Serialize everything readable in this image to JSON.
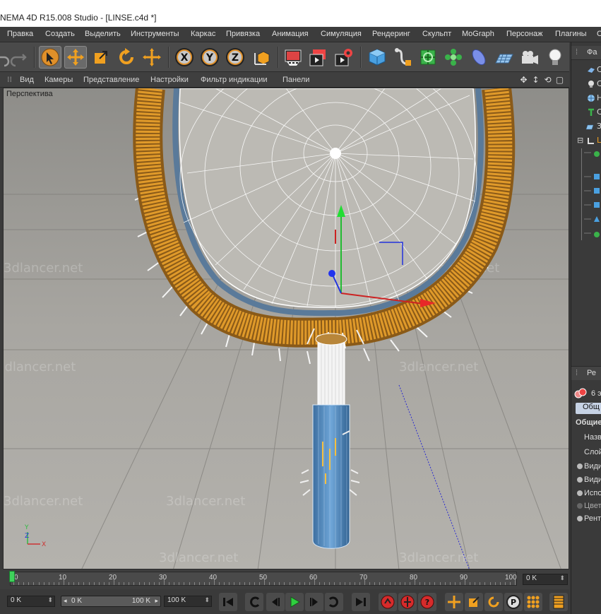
{
  "window": {
    "title": "NEMA 4D R15.008 Studio - [LINSE.c4d *]"
  },
  "menu": {
    "items": [
      "Правка",
      "Создать",
      "Выделить",
      "Инструменты",
      "Каркас",
      "Привязка",
      "Анимация",
      "Симуляция",
      "Рендеринг",
      "Скульпт",
      "MoGraph",
      "Персонаж",
      "Плагины",
      "С"
    ]
  },
  "toolbar": {
    "tools": [
      "undo-icon",
      "redo-icon",
      "select-arrow-icon",
      "move-icon",
      "scale-icon",
      "rotate-icon",
      "move-plus-icon",
      "x-axis-icon",
      "y-axis-icon",
      "z-axis-icon",
      "coordinate-system-icon",
      "render-view-icon",
      "render-picture-queue-icon",
      "render-settings-icon",
      "cube-icon",
      "spline-pen-icon",
      "subdivision-icon",
      "cloner-icon",
      "deformer-icon",
      "floor-icon",
      "camera-icon",
      "light-icon"
    ]
  },
  "viewport_menu": {
    "items": [
      "Вид",
      "Камеры",
      "Представление",
      "Настройки",
      "Фильтр индикации",
      "Панели"
    ]
  },
  "viewport": {
    "label": "Перспектива",
    "watermark": "3dlancer.net"
  },
  "right_panel": {
    "objects_header": "Фа",
    "objects": [
      {
        "icon": "camera-object-icon",
        "label": "С"
      },
      {
        "icon": "light-bulb-icon",
        "label": "С"
      },
      {
        "icon": "sky-sphere-icon",
        "label": "Н"
      },
      {
        "icon": "text-object-icon",
        "label": "С"
      },
      {
        "icon": "floor-object-icon",
        "label": "З"
      },
      {
        "icon": "null-object-icon",
        "label": "L"
      }
    ],
    "attributes_header": "Ре",
    "attributes_mode": "6 э",
    "tab": "Общ",
    "section": "Общие",
    "fields": [
      "Назв",
      "Слой",
      "Види",
      "Види",
      "Испо",
      "Цвет",
      "Рент"
    ]
  },
  "timeline": {
    "ticks": [
      "0",
      "10",
      "20",
      "30",
      "40",
      "50",
      "60",
      "70",
      "80",
      "90",
      "100"
    ],
    "current_frame_field": "0 K"
  },
  "transport": {
    "start_field": "0 K",
    "range_min": "0 K",
    "range_max": "100 K",
    "end_field": "100 K",
    "buttons": [
      "go-to-start-icon",
      "previous-key-icon",
      "previous-frame-icon",
      "play-icon",
      "next-frame-icon",
      "next-key-icon",
      "go-to-end-icon",
      "record-keys-icon",
      "autokey-icon",
      "keyframe-selection-icon",
      "key-position-icon",
      "key-scale-icon",
      "key-rotation-icon",
      "key-parameter-icon",
      "key-pla-icon",
      "timeline-window-icon"
    ]
  }
}
